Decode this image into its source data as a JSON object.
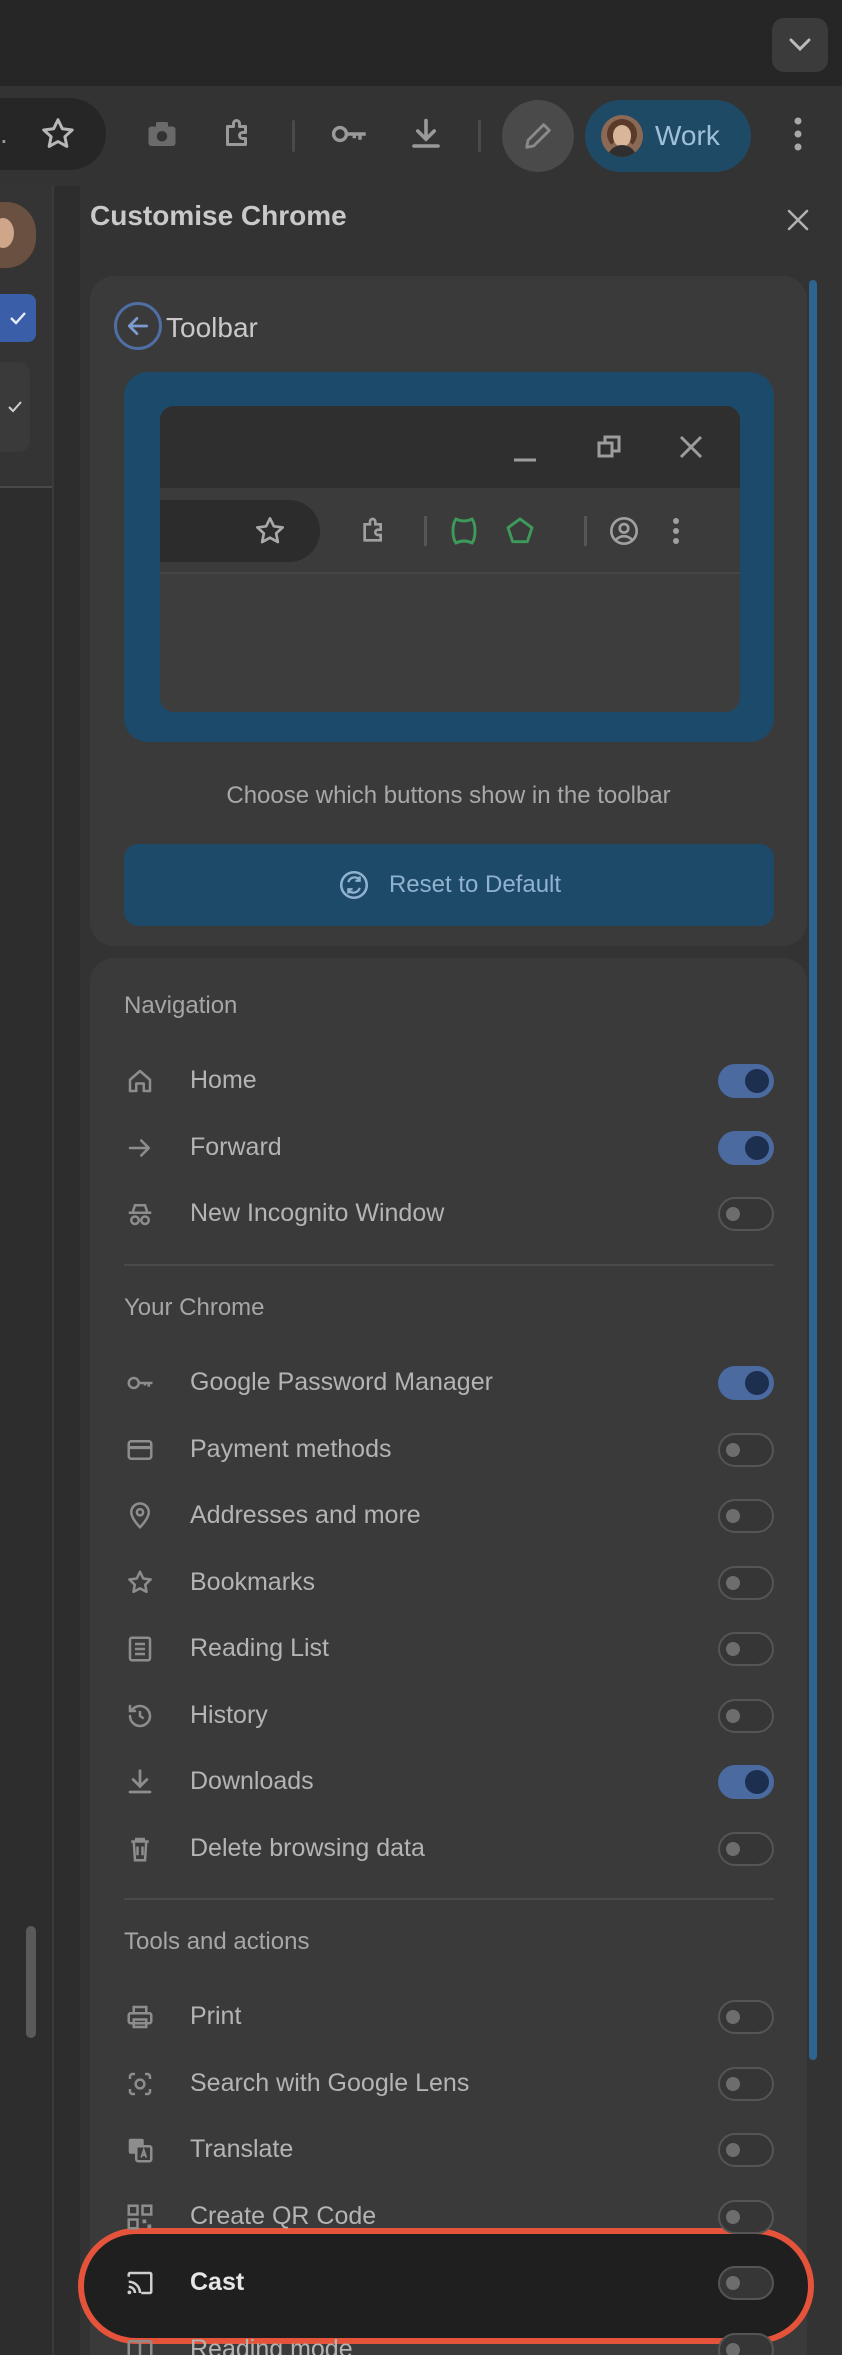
{
  "toolbar": {
    "omnibox_tail_text": ".",
    "profile_label": "Work"
  },
  "side_panel": {
    "title": "Customise Chrome",
    "close_icon": "close-icon",
    "toolbar_card": {
      "title": "Toolbar",
      "caption": "Choose which buttons show in the toolbar",
      "reset_label": "Reset to Default"
    },
    "sections": [
      {
        "title": "Navigation",
        "items": [
          {
            "label": "Home",
            "icon": "home-icon",
            "on": true
          },
          {
            "label": "Forward",
            "icon": "forward-arrow-icon",
            "on": true
          },
          {
            "label": "New Incognito Window",
            "icon": "incognito-icon",
            "on": false
          }
        ]
      },
      {
        "title": "Your Chrome",
        "items": [
          {
            "label": "Google Password Manager",
            "icon": "key-icon",
            "on": true
          },
          {
            "label": "Payment methods",
            "icon": "credit-card-icon",
            "on": false
          },
          {
            "label": "Addresses and more",
            "icon": "location-pin-icon",
            "on": false
          },
          {
            "label": "Bookmarks",
            "icon": "bookmark-star-icon",
            "on": false
          },
          {
            "label": "Reading List",
            "icon": "reading-list-icon",
            "on": false
          },
          {
            "label": "History",
            "icon": "history-icon",
            "on": false
          },
          {
            "label": "Downloads",
            "icon": "download-icon",
            "on": true
          },
          {
            "label": "Delete browsing data",
            "icon": "trash-icon",
            "on": false
          }
        ]
      },
      {
        "title": "Tools and actions",
        "items": [
          {
            "label": "Print",
            "icon": "print-icon",
            "on": false
          },
          {
            "label": "Search with Google Lens",
            "icon": "lens-icon",
            "on": false
          },
          {
            "label": "Translate",
            "icon": "translate-icon",
            "on": false
          },
          {
            "label": "Create QR Code",
            "icon": "qr-code-icon",
            "on": false
          },
          {
            "label": "Cast",
            "icon": "cast-icon",
            "on": false,
            "highlighted": true
          },
          {
            "label": "Reading mode",
            "icon": "reading-mode-icon",
            "on": false
          }
        ]
      }
    ]
  },
  "colors": {
    "highlight_ring": "#e5533a",
    "toggle_on": "#4a6aa0",
    "accent_blue": "#1f4a66"
  }
}
